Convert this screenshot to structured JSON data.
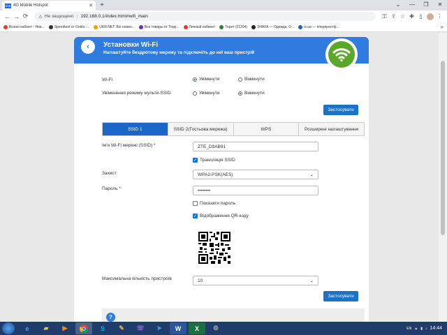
{
  "browser": {
    "tab_title": "4G Mobile Hotspot",
    "tab_favicon": "ZTE",
    "not_secure": "Не защищено",
    "url": "192.168.0.1/index.html#wifi_main",
    "bookmarks": [
      {
        "label": "Бізнес-кабінет - Нов...",
        "color": "#e53935"
      },
      {
        "label": "Speedtest от Ookla -...",
        "color": "#333333"
      },
      {
        "label": "UKR.NET: Всі новин...",
        "color": "#ff9800"
      },
      {
        "label": "Все товары от Терр...",
        "color": "#5e35b1"
      },
      {
        "label": "Личный кабинет",
        "color": "#e53935"
      },
      {
        "label": "Терет (21294)",
        "color": "#2e7d32"
      },
      {
        "label": "SHAFA — Одежда, О...",
        "color": "#222222"
      },
      {
        "label": "iz.ua — пперпростір...",
        "color": "#1565c0"
      }
    ]
  },
  "header": {
    "title": "Установки Wi-Fi",
    "subtitle": "Налаштуйте бездротову мережу та підключіть до неї ваш пристрій"
  },
  "settings": {
    "wifi_label": "Wi-Fi",
    "wifi_on": "Увімкнути",
    "wifi_off": "Вимкнути",
    "multi_ssid_label": "Увімкнення режиму мульти-SSID",
    "multi_on": "Увімкнути",
    "multi_off": "Вимкнути",
    "apply_label": "Застосувати"
  },
  "tabs": [
    {
      "label": "SSID 1"
    },
    {
      "label": "SSID 2(Гостьова мережа)"
    },
    {
      "label": "WPS"
    },
    {
      "label": "Розширені налаштування"
    }
  ],
  "form": {
    "ssid_label": "Ім'я Wi-Fi мережі (SSID) *",
    "ssid_value": "ZTE_D9AB91",
    "broadcast_label": "Трансляція SSID",
    "security_label": "Захист",
    "security_value": "WPA2-PSK(AES)",
    "password_label": "Пароль *",
    "password_value": "••••••••",
    "show_password_label": "Показати пароль",
    "qr_label": "Відображення QR-коду",
    "max_devices_label": "Максимальна кількість пристроїв",
    "max_devices_value": "10",
    "apply_label": "Застосувати"
  },
  "taskbar": {
    "lang": "EN",
    "time": "14:44"
  }
}
